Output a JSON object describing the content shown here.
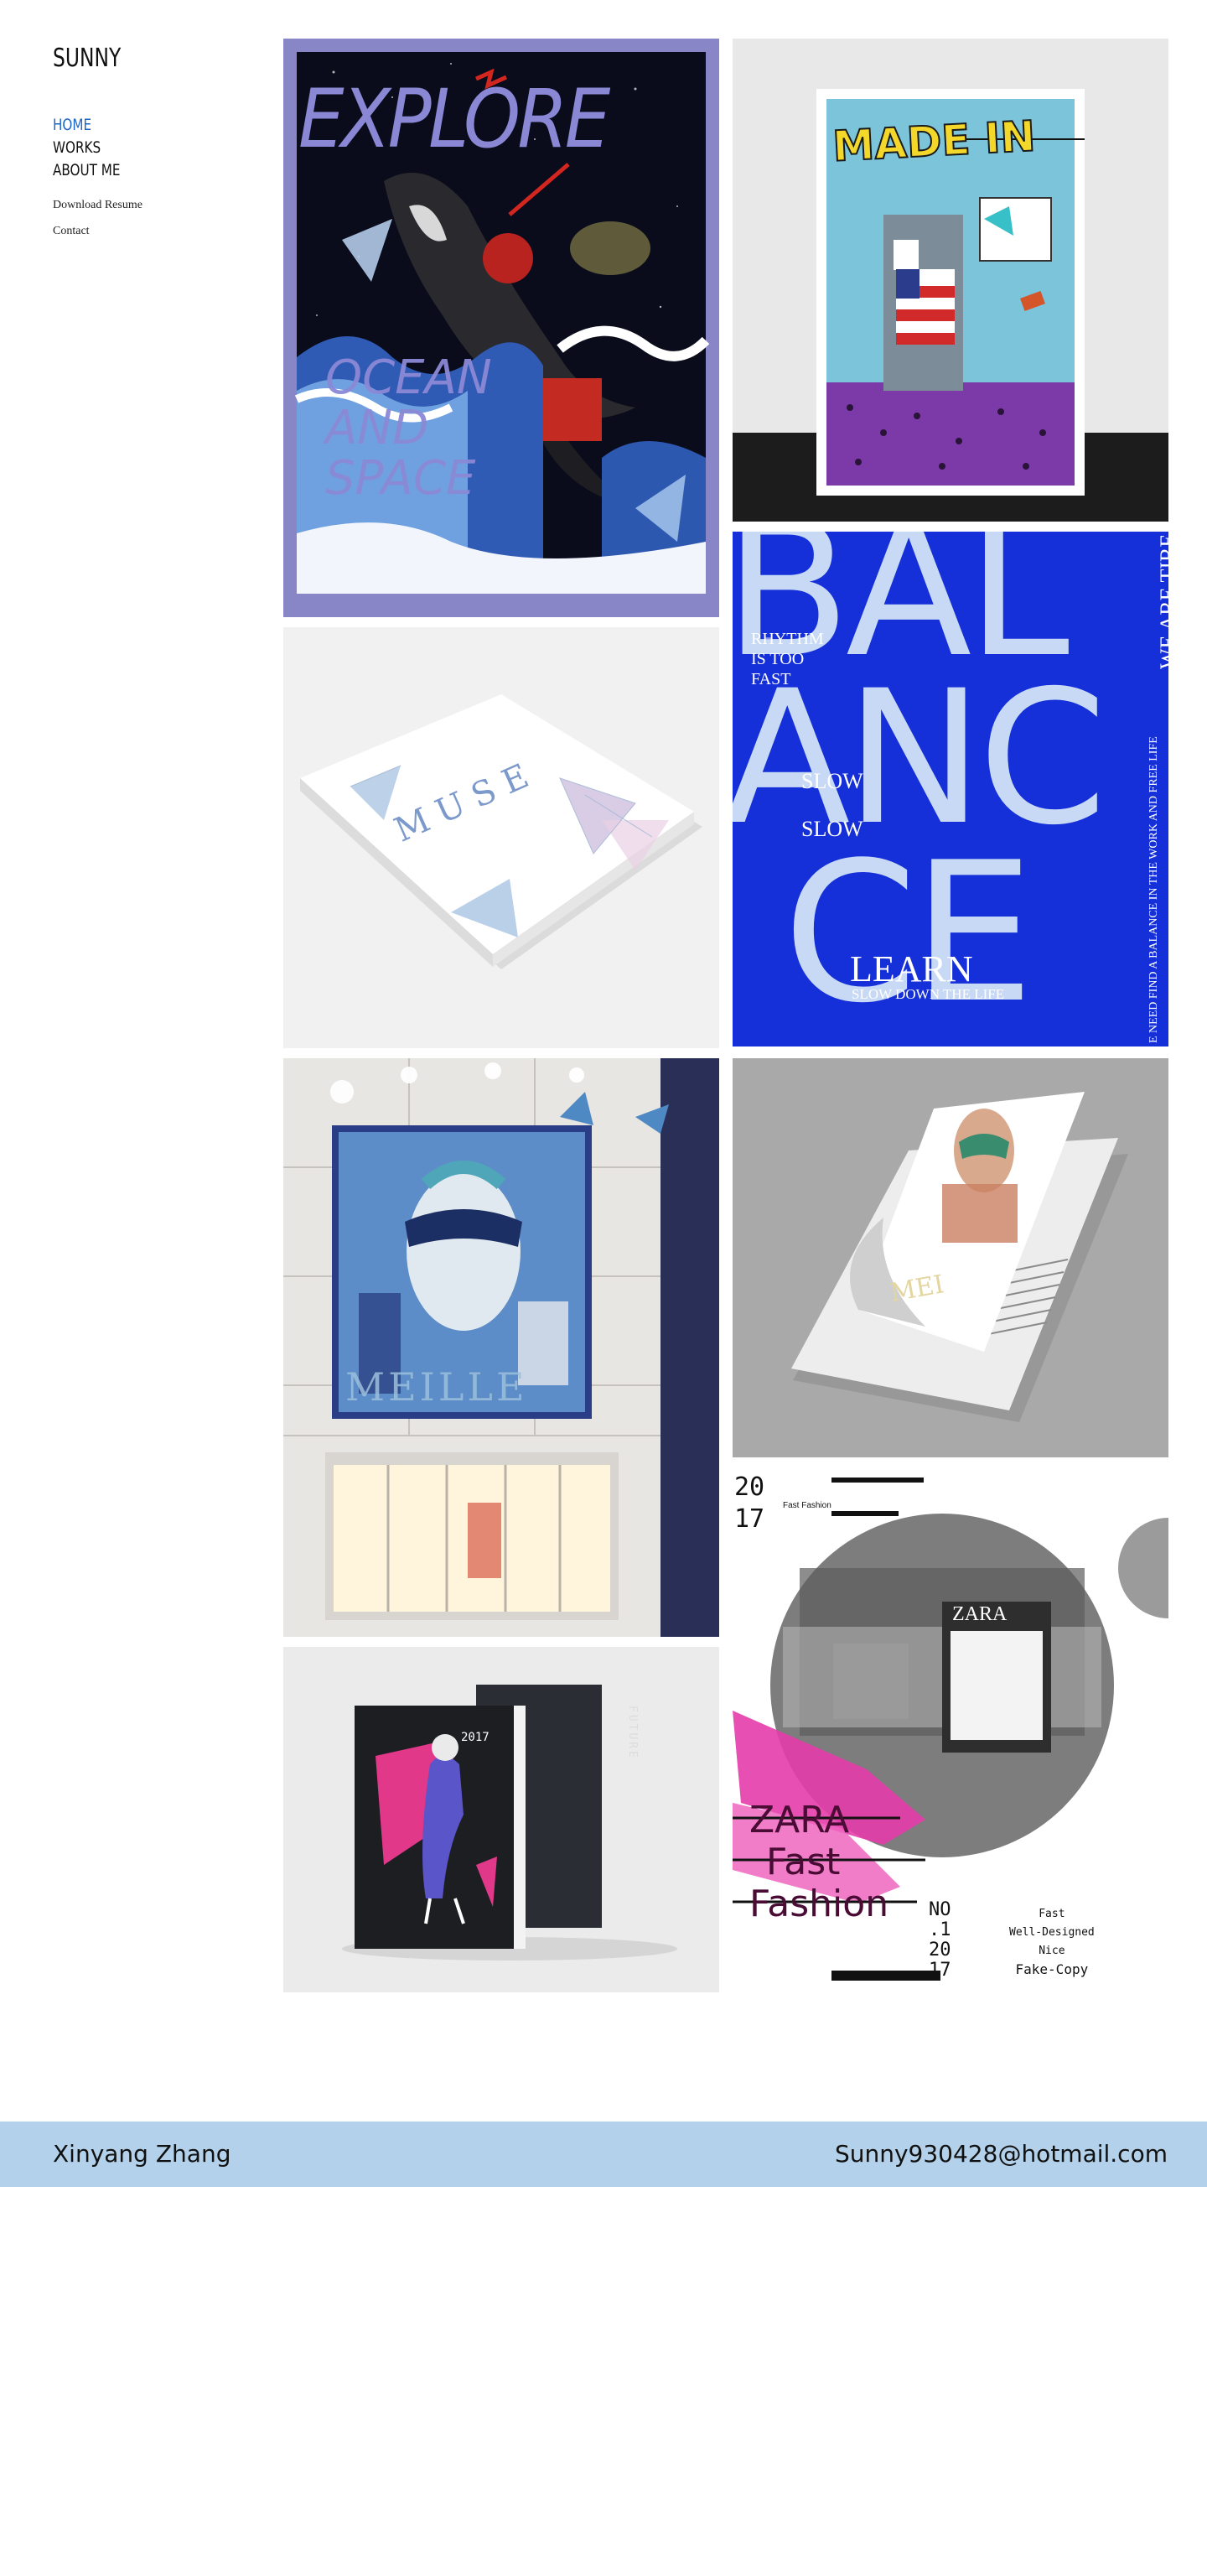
{
  "site": {
    "brand": "SUNNY"
  },
  "nav": {
    "items": [
      {
        "label": "HOME",
        "active": true
      },
      {
        "label": "WORKS",
        "active": false
      },
      {
        "label": "ABOUT ME",
        "active": false
      }
    ],
    "secondary": [
      {
        "label": "Download Resume"
      },
      {
        "label": "Contact"
      }
    ]
  },
  "works": {
    "explore": {
      "title": "EXPLORE",
      "sub1": "OCEAN",
      "sub2": "AND",
      "sub3": "SPACE"
    },
    "made_in": {
      "title": "MADE IN"
    },
    "balance": {
      "word1": "BAL",
      "word2": "ANC",
      "word3": "CE",
      "rhythm1": "RHYTHM",
      "rhythm2": "IS TOO",
      "rhythm3": "FAST",
      "slow1": "SLOW",
      "slow2": "SLOW",
      "learn": "LEARN",
      "learn_sub": "SLOW DOWN THE LIFE",
      "side1": "WE ARE TIRE",
      "side2": "E NEED FIND A BALANCE IN THE WORK AND FREE LIFE"
    },
    "meille": {
      "title": "MEILLE"
    },
    "future": {
      "year": "2017",
      "spine": "FUTURE"
    },
    "zara": {
      "year_a": "20",
      "year_b": "17",
      "tag": "Fast Fashion",
      "title1": "ZARA",
      "title2": "Fast",
      "title3": "Fashion",
      "store": "ZARA",
      "no1": "NO",
      "no2": ".1",
      "no3": "20",
      "no4": "17",
      "list1": "Fast",
      "list2": "Well-Designed",
      "list3": "Nice",
      "list4": "Fake-Copy"
    }
  },
  "footer": {
    "name": "Xinyang Zhang",
    "email": "Sunny930428@hotmail.com"
  },
  "colors": {
    "accent": "#1c66c8",
    "footer_bg": "#b3d1ea",
    "balance_blue": "#1530d8"
  }
}
